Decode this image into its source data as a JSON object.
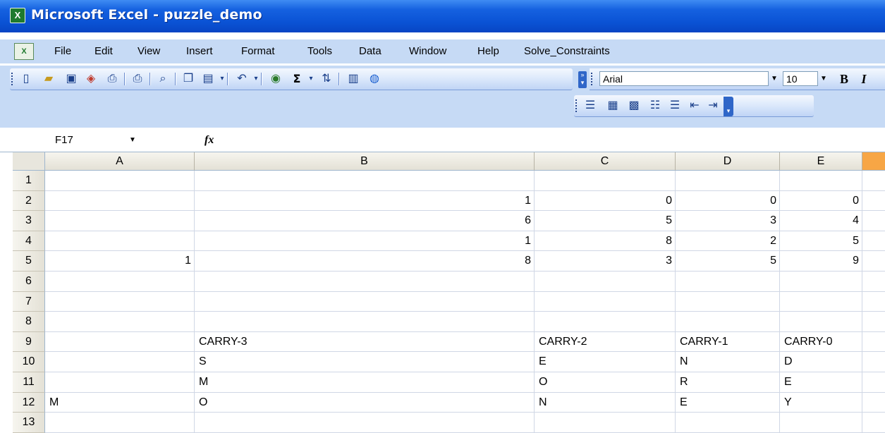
{
  "window": {
    "title": "Microsoft Excel - puzzle_demo",
    "app_icon": "excel-icon"
  },
  "menu": [
    "File",
    "Edit",
    "View",
    "Insert",
    "Format",
    "Tools",
    "Data",
    "Window",
    "Help",
    "Solve_Constraints"
  ],
  "toolbar": {
    "font_name": "Arial",
    "font_size": "10",
    "bold_label": "B",
    "italic_label": "I",
    "sigma_label": "Σ",
    "standard_icons": [
      "new-icon",
      "open-icon",
      "save-icon",
      "permission-icon",
      "print-preview-icon",
      "print-icon",
      "research-icon",
      "copy-icon",
      "paste-icon",
      "undo-icon",
      "hyperlink-icon",
      "autosum-icon",
      "sort-ascending-icon",
      "chart-icon",
      "help-icon"
    ],
    "formatting_icons": [
      "align-justify-icon",
      "merge-icon",
      "merge-center-icon",
      "numbered-list-icon",
      "bullet-list-icon",
      "decrease-indent-icon",
      "increase-indent-icon"
    ]
  },
  "formula_bar": {
    "name_box": "F17",
    "fx_label": "fx",
    "formula": ""
  },
  "sheet": {
    "columns": [
      "A",
      "B",
      "C",
      "D",
      "E",
      ""
    ],
    "rows": [
      {
        "num": "1",
        "cells": [
          "",
          "",
          "",
          "",
          ""
        ]
      },
      {
        "num": "2",
        "cells": [
          "",
          "1",
          "0",
          "0",
          "0"
        ]
      },
      {
        "num": "3",
        "cells": [
          "",
          "6",
          "5",
          "3",
          "4"
        ]
      },
      {
        "num": "4",
        "cells": [
          "",
          "1",
          "8",
          "2",
          "5"
        ]
      },
      {
        "num": "5",
        "cells": [
          "1",
          "8",
          "3",
          "5",
          "9"
        ]
      },
      {
        "num": "6",
        "cells": [
          "",
          "",
          "",
          "",
          ""
        ]
      },
      {
        "num": "7",
        "cells": [
          "",
          "",
          "",
          "",
          ""
        ]
      },
      {
        "num": "8",
        "cells": [
          "",
          "",
          "",
          "",
          ""
        ]
      },
      {
        "num": "9",
        "cells": [
          "",
          "CARRY-3",
          "CARRY-2",
          "CARRY-1",
          "CARRY-0"
        ]
      },
      {
        "num": "10",
        "cells": [
          "",
          "S",
          "E",
          "N",
          "D"
        ]
      },
      {
        "num": "11",
        "cells": [
          "",
          "M",
          "O",
          "R",
          "E"
        ]
      },
      {
        "num": "12",
        "cells": [
          "M",
          "O",
          "N",
          "E",
          "Y"
        ]
      },
      {
        "num": "13",
        "cells": [
          "",
          "",
          "",
          "",
          ""
        ]
      }
    ]
  }
}
